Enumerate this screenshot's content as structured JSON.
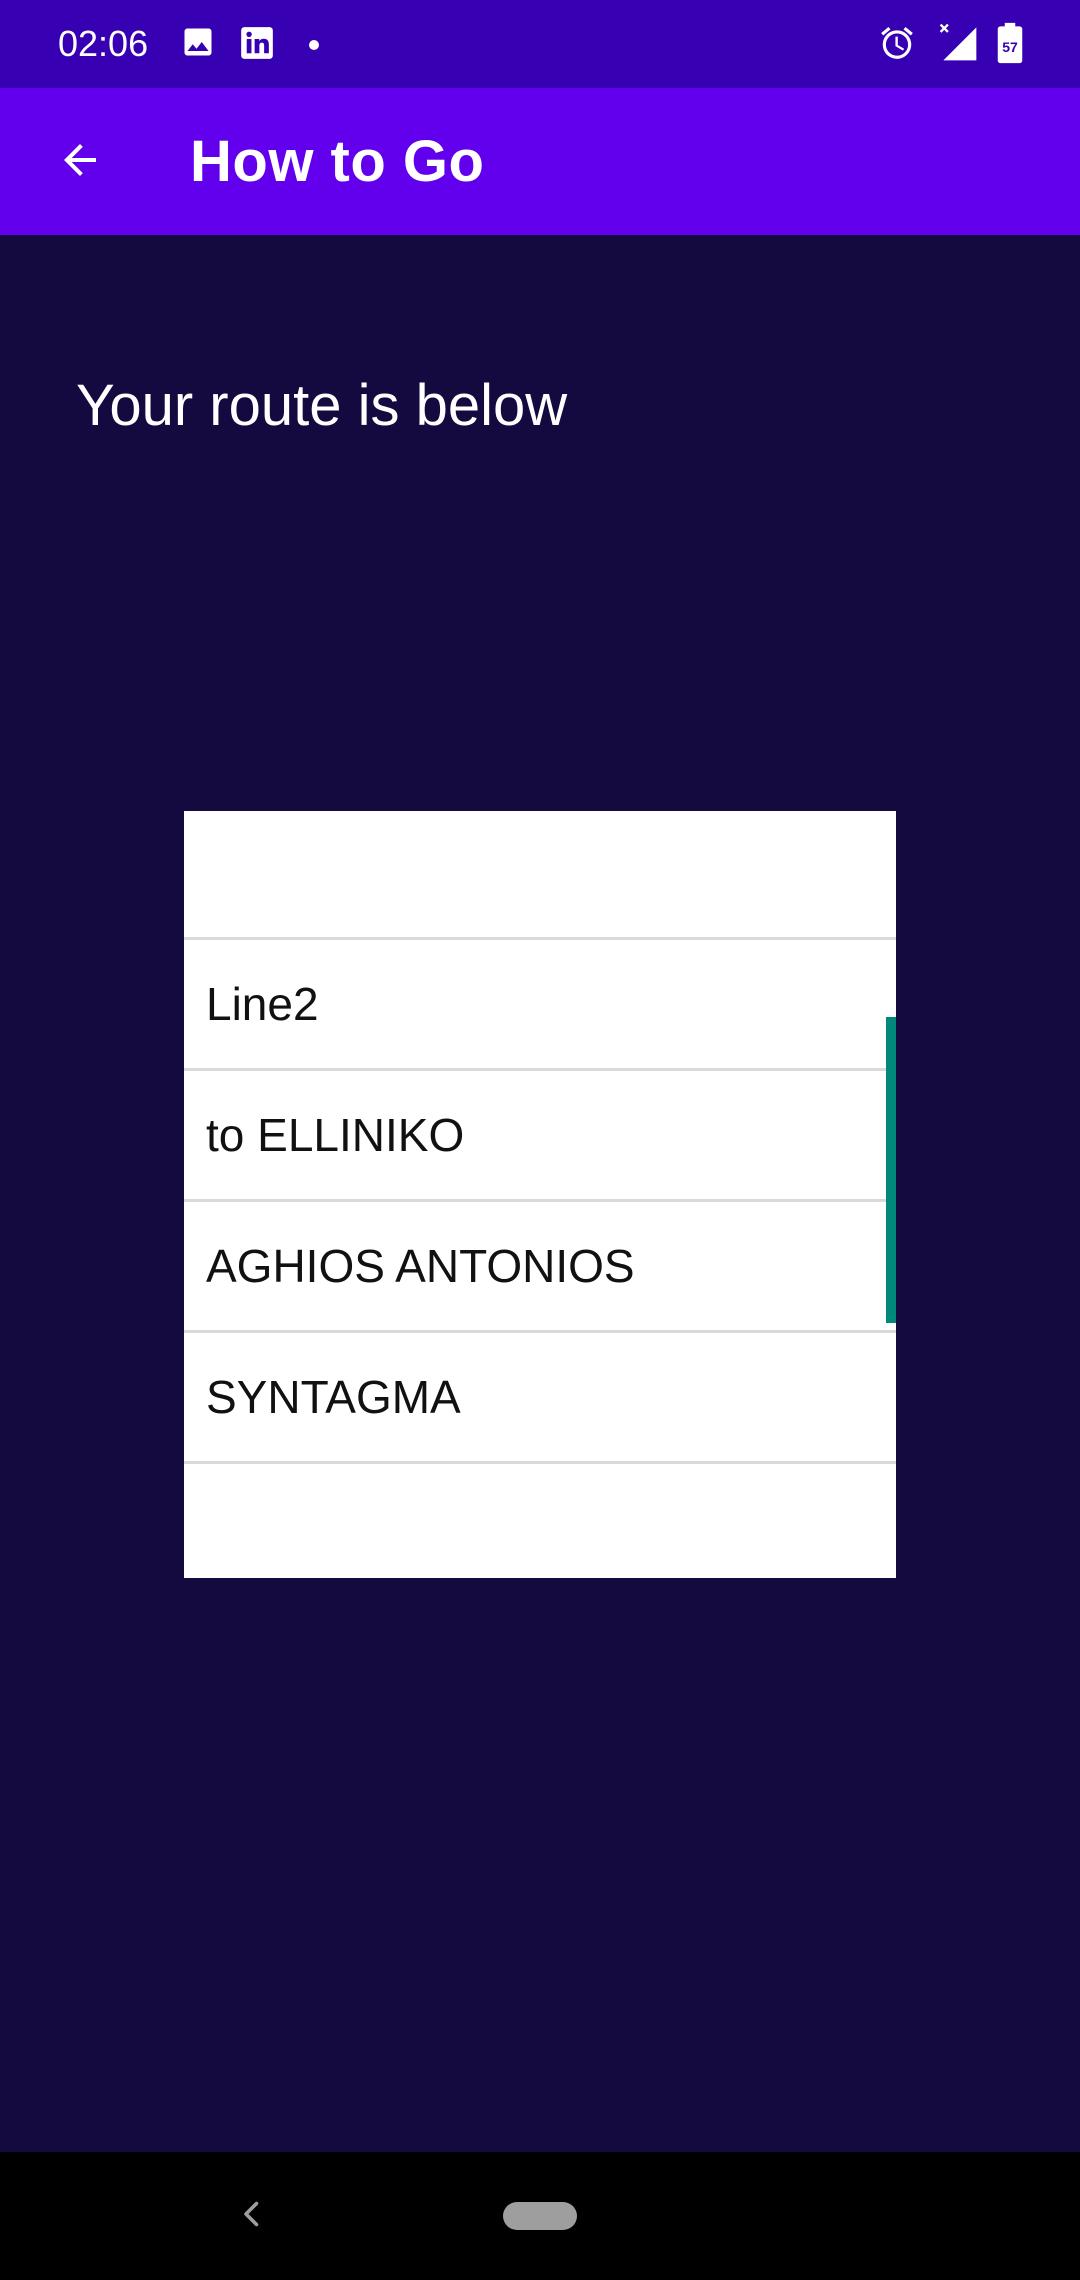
{
  "status_bar": {
    "time": "02:06",
    "battery_level": "57",
    "icons": [
      "image-icon",
      "linkedin-icon",
      "dot-icon",
      "alarm-icon",
      "signal-icon",
      "battery-icon"
    ]
  },
  "app_bar": {
    "title": "How to Go",
    "back_icon": "arrow-back-icon"
  },
  "main": {
    "heading": "Your route is below",
    "route_items": [
      "",
      "Line2",
      "to ELLINIKO",
      "AGHIOS ANTONIOS",
      "SYNTAGMA",
      ""
    ]
  },
  "colors": {
    "status_bar": "#3700b3",
    "app_bar": "#6200ee",
    "background": "#140a40",
    "scroll_thumb": "#00897b"
  }
}
